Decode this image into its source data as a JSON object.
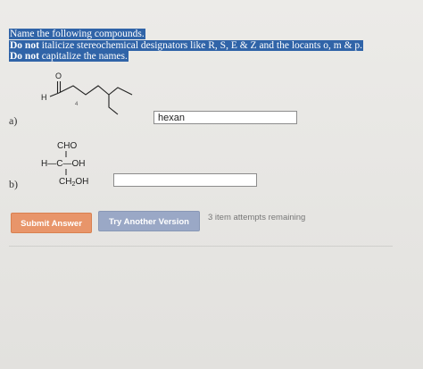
{
  "instructions": {
    "line1": "Name the following compounds.",
    "line2_bold": "Do not",
    "line2_rest": " italicize stereochemical designators like R, S, E & Z and the locants o, m & p.",
    "line3_bold": "Do not",
    "line3_rest": " capitalize the names."
  },
  "questions": [
    {
      "label": "a)",
      "structure": {
        "atom_O": "O",
        "atom_H": "H",
        "locant": "4"
      },
      "answer_value": "hexan"
    },
    {
      "label": "b)",
      "structure": {
        "top": "CHO",
        "middle": "H—C—OH",
        "bottom_prefix": "CH",
        "bottom_sub": "2",
        "bottom_suffix": "OH"
      },
      "answer_value": ""
    }
  ],
  "buttons": {
    "submit": "Submit Answer",
    "try_another": "Try Another Version"
  },
  "status": {
    "attempts": "3 item attempts remaining"
  },
  "colors": {
    "highlight": "#3064a8",
    "submit": "#e8956a",
    "try_another": "#9aa8c6"
  }
}
